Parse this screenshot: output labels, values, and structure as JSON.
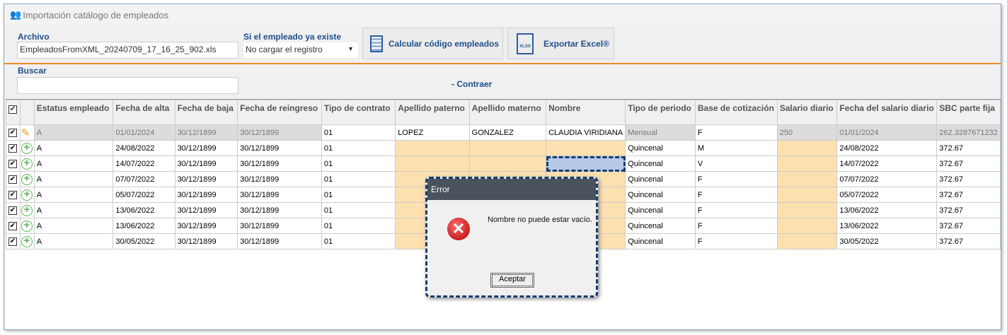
{
  "title": "Importación catálogo de empleados",
  "archivo": {
    "label": "Archivo",
    "value": "EmpleadosFromXML_20240709_17_16_25_902.xls"
  },
  "existe": {
    "label": "Si el empleado ya existe",
    "value": "No cargar el registro"
  },
  "calc_button": "Calcular código empleados",
  "export_button": "Exportar Excel®",
  "export_icon_text": "XLSX",
  "buscar": {
    "label": "Buscar",
    "value": ""
  },
  "contraer": "- Contraer",
  "columns": [
    "Estatus empleado",
    "Fecha de alta",
    "Fecha de baja",
    "Fecha de reingreso",
    "Tipo de contrato",
    "Apellido paterno",
    "Apellido materno",
    "Nombre",
    "Tipo de periodo",
    "Base de cotización",
    "Salario diario",
    "Fecha del salario diario",
    "SBC parte fija"
  ],
  "rows": [
    [
      "A",
      "01/01/2024",
      "30/12/1899",
      "30/12/1899",
      "01",
      "LOPEZ",
      "GONZALEZ",
      "CLAUDIA VIRIDIANA",
      "Mensual",
      "F",
      "250",
      "01/01/2024",
      "262.3287671232"
    ],
    [
      "A",
      "24/08/2022",
      "30/12/1899",
      "30/12/1899",
      "01",
      "",
      "",
      "",
      "Quincenal",
      "M",
      "",
      "24/08/2022",
      "372.67"
    ],
    [
      "A",
      "14/07/2022",
      "30/12/1899",
      "30/12/1899",
      "01",
      "",
      "",
      "",
      "Quincenal",
      "V",
      "",
      "14/07/2022",
      "372.67"
    ],
    [
      "A",
      "07/07/2022",
      "30/12/1899",
      "30/12/1899",
      "01",
      "",
      "",
      "",
      "Quincenal",
      "F",
      "",
      "07/07/2022",
      "372.67"
    ],
    [
      "A",
      "05/07/2022",
      "30/12/1899",
      "30/12/1899",
      "01",
      "",
      "",
      "",
      "Quincenal",
      "F",
      "",
      "05/07/2022",
      "372.67"
    ],
    [
      "A",
      "13/06/2022",
      "30/12/1899",
      "30/12/1899",
      "01",
      "",
      "",
      "",
      "Quincenal",
      "F",
      "",
      "13/06/2022",
      "372.67"
    ],
    [
      "A",
      "13/06/2022",
      "30/12/1899",
      "30/12/1899",
      "01",
      "",
      "",
      "",
      "Quincenal",
      "F",
      "",
      "13/06/2022",
      "372.67"
    ],
    [
      "A",
      "30/05/2022",
      "30/12/1899",
      "30/12/1899",
      "01",
      "",
      "",
      "",
      "Quincenal",
      "F",
      "",
      "30/05/2022",
      "372.67"
    ]
  ],
  "dialog": {
    "title": "Error",
    "message": "Nombre no puede estar vacío.",
    "ok": "Aceptar"
  }
}
